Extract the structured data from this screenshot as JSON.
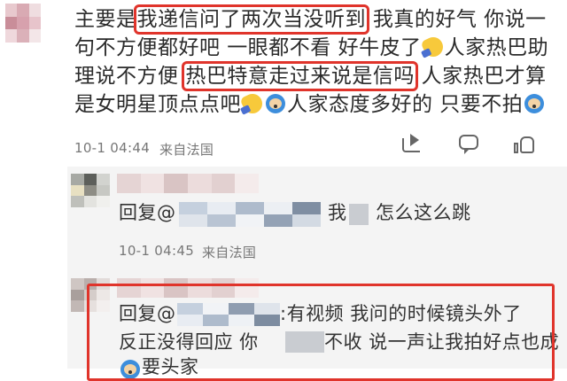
{
  "main_comment": {
    "seg1": "主要是",
    "highlight1": "我递信问了两次当没听到",
    "seg2": "我真的好气 你说一句不方便都好吧 一眼都不看 好牛皮了",
    "seg3": "人家热巴助理说不方便",
    "highlight2": "热巴特意走过来说是信吗",
    "seg4": "人家热巴才算是女明星顶点点吧",
    "seg5": "人家态度多好的 只要不拍",
    "timestamp": "10-1 04:44",
    "source": "来自法国",
    "emojis": [
      "thumb-emoji",
      "thumb-emoji",
      "face-emoji",
      "face-emoji"
    ]
  },
  "reply1": {
    "prefix": "回复@",
    "text_a": "我",
    "text_b": "怎么这么跳",
    "timestamp": "10-1 04:45",
    "source": "来自法国"
  },
  "reply2": {
    "prefix": "回复@",
    "line1": ":有视频 我问的时候镜头外了",
    "line2a": "反正没得回应 你",
    "line2b": "不收 说一声让我拍好点也成",
    "line3": "要头家"
  },
  "icons": [
    "share-icon",
    "comment-icon",
    "like-icon",
    "avatar"
  ],
  "colors": {
    "highlight_border": "#e0342b",
    "reply_bg": "#f4f4f4",
    "meta_text": "#777777"
  }
}
